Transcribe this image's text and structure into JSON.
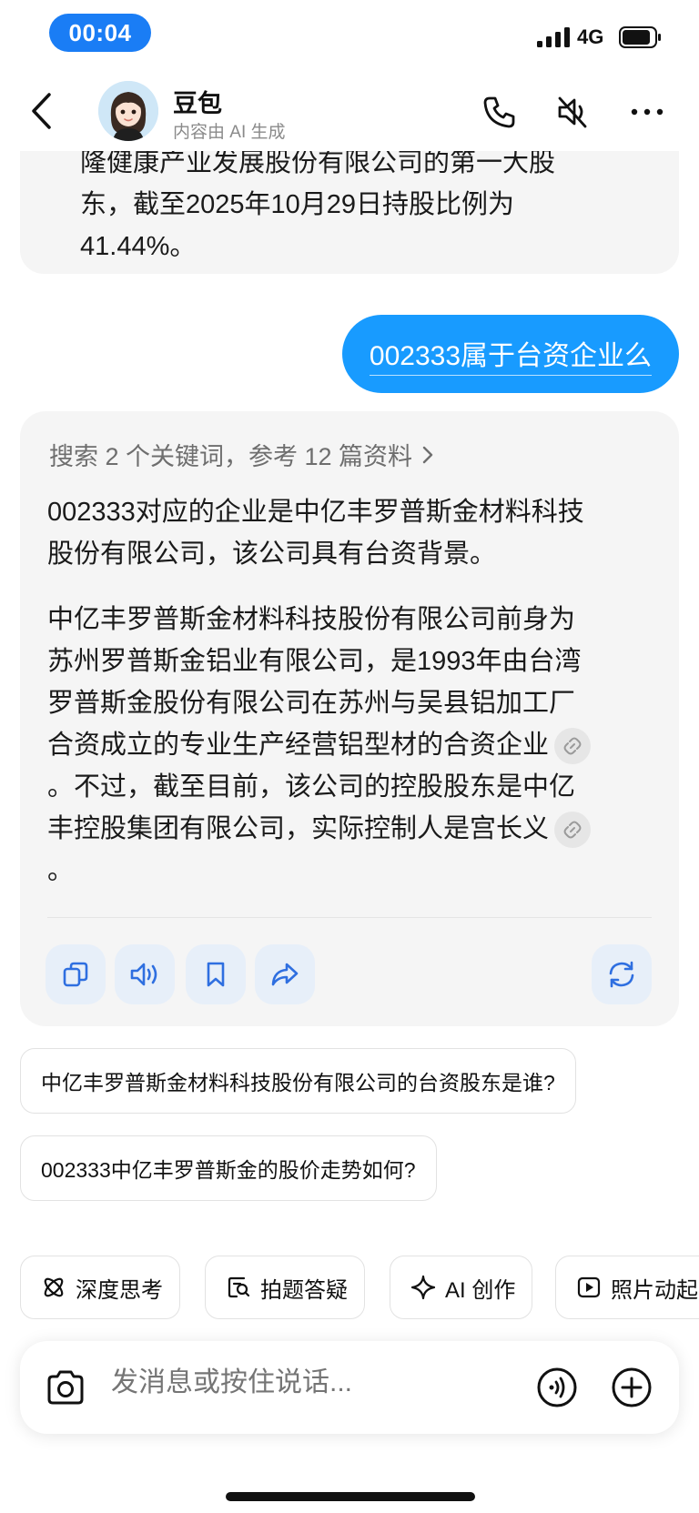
{
  "status_bar": {
    "time": "00:04",
    "network": "4G"
  },
  "header": {
    "name": "豆包",
    "subtitle": "内容由 AI 生成",
    "icons": [
      "back-icon",
      "phone-icon",
      "mute-icon",
      "more-icon"
    ]
  },
  "previous_message": {
    "lines": [
      "隆健康产业发展股份有限公司的第一大股",
      "东，截至2025年10月29日持股比例为",
      "41.44%。"
    ]
  },
  "user_message": {
    "text": "002333属于台资企业么"
  },
  "ai_message": {
    "search_ref": "搜索 2 个关键词，参考 12 篇资料",
    "para1_lines": [
      "002333对应的企业是中亿丰罗普斯金材料科技",
      "股份有限公司，该公司具有台资背景。"
    ],
    "para2_lines": [
      "中亿丰罗普斯金材料科技股份有限公司前身为",
      "苏州罗普斯金铝业有限公司，是1993年由台湾",
      "罗普斯金股份有限公司在苏州与吴县铝加工厂",
      "合资成立的专业生产经营铝型材的合资企业",
      "。不过，截至目前，该公司的控股股东是中亿",
      "丰控股集团有限公司，实际控制人是宫长义",
      "。"
    ],
    "actions": [
      "copy-icon",
      "speaker-icon",
      "bookmark-icon",
      "share-icon",
      "regenerate-icon"
    ]
  },
  "suggestions": [
    "中亿丰罗普斯金材料科技股份有限公司的台资股东是谁?",
    "002333中亿丰罗普斯金的股价走势如何?"
  ],
  "tools": [
    {
      "label": "深度思考",
      "icon": "atom-icon"
    },
    {
      "label": "拍题答疑",
      "icon": "photo-search-icon"
    },
    {
      "label": "AI 创作",
      "icon": "sparkle-icon"
    },
    {
      "label": "照片动起",
      "icon": "play-icon"
    }
  ],
  "input": {
    "placeholder": "发消息或按住说话..."
  },
  "colors": {
    "accent": "#1a7df5",
    "user_bubble": "#189bff",
    "bubble_bg": "#f5f5f5",
    "action_bg": "#e7eff9",
    "icon_blue": "#2f6fe0"
  }
}
